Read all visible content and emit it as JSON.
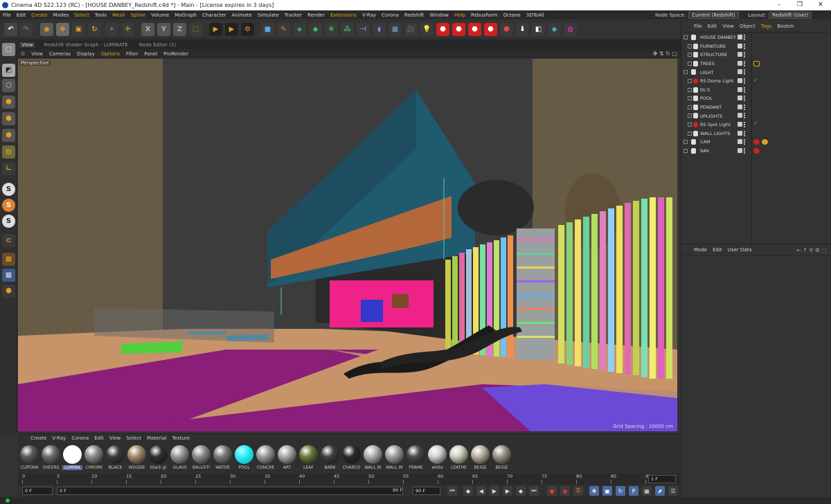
{
  "window": {
    "title": "Cinema 4D S22.123 (RC) - [HOUSE DANBEY_Redshift.c4d *] - Main - [License expires in 3 days]",
    "controls": [
      "–",
      "❐",
      "✕"
    ]
  },
  "menu": [
    "File",
    "Edit",
    "Create",
    "Modes",
    "Select",
    "Tools",
    "Mesh",
    "Spline",
    "Volume",
    "MoGraph",
    "Character",
    "Animate",
    "Simulate",
    "Tracker",
    "Render",
    "Extensions",
    "V-Ray",
    "Corona",
    "Redshift",
    "Window",
    "Help",
    "RebusFarm",
    "Octane",
    "3DToAll"
  ],
  "node_space": {
    "label": "Node Space:",
    "value": "Current (Redshift)"
  },
  "layout": {
    "label": "Layout:",
    "value": "Redshift (User)"
  },
  "viewport_tabs": [
    "View",
    "Redshift Shader Graph - LUMINATE",
    "Node Editor (1)"
  ],
  "viewport_menu": [
    "View",
    "Cameras",
    "Display",
    "Options",
    "Filter",
    "Panel",
    "ProRender"
  ],
  "viewport": {
    "camera_label": "Perspective",
    "grid_spacing": "Grid Spacing : 10000 cm"
  },
  "object_manager": {
    "menu": [
      "File",
      "Edit",
      "View",
      "Object",
      "Tags",
      "Bookm"
    ],
    "objects": [
      {
        "name": "HOUSE DANBEY",
        "type": "layer",
        "tag": ""
      },
      {
        "name": "FURNITURE",
        "type": "layer",
        "tag": ""
      },
      {
        "name": "STRUCTURE",
        "type": "layer",
        "tag": ""
      },
      {
        "name": "TREES",
        "type": "layer",
        "tag": "orange"
      },
      {
        "name": "LIGHT",
        "type": "layer",
        "tag": ""
      },
      {
        "name": "RS Dome Light",
        "type": "rs",
        "tag": "check"
      },
      {
        "name": "DL'S",
        "type": "layer",
        "tag": ""
      },
      {
        "name": "POOL",
        "type": "layer",
        "tag": ""
      },
      {
        "name": "PENDANT",
        "type": "layer",
        "tag": ""
      },
      {
        "name": "UPLIGHTS",
        "type": "layer",
        "tag": ""
      },
      {
        "name": "RS Spot Light",
        "type": "rs",
        "tag": "check"
      },
      {
        "name": "WALL LIGHTS",
        "type": "layer",
        "tag": ""
      },
      {
        "name": "CAM",
        "type": "cam",
        "tag": "red2"
      },
      {
        "name": "NAV",
        "type": "null",
        "tag": "red"
      }
    ]
  },
  "attributes": {
    "menu": [
      "Mode",
      "Edit",
      "User Data"
    ]
  },
  "material_manager": {
    "menu": [
      "Create",
      "V-Ray",
      "Corona",
      "Edit",
      "View",
      "Select",
      "Material",
      "Texture"
    ],
    "materials": [
      {
        "name": "CURTAIN",
        "color": "#5a5a5a"
      },
      {
        "name": "SHEERS",
        "color": "#6a6a6a"
      },
      {
        "name": "LUMINA",
        "color": "#ffffff",
        "selected": true
      },
      {
        "name": "CHROMI",
        "color": "#8a8a8a"
      },
      {
        "name": "BLACK",
        "color": "#3a3a3a"
      },
      {
        "name": "WOODE",
        "color": "#a38a6a"
      },
      {
        "name": "black gl",
        "color": "#2e2e2e"
      },
      {
        "name": "GLASS",
        "color": "#9a9a9a"
      },
      {
        "name": "BALUSTI",
        "color": "#8c8c8c"
      },
      {
        "name": "WATER",
        "color": "#7a7a7a"
      },
      {
        "name": "POOL",
        "color": "#22e6f0"
      },
      {
        "name": "CONCRE",
        "color": "#9c9c9c"
      },
      {
        "name": "ART",
        "color": "#a8a8a8"
      },
      {
        "name": "LEAF",
        "color": "#6a7a3a"
      },
      {
        "name": "BARK",
        "color": "#404040"
      },
      {
        "name": "CHARCO",
        "color": "#2a2a2a"
      },
      {
        "name": "WALL BI",
        "color": "#b0b0b0"
      },
      {
        "name": "WALL W",
        "color": "#a0a0a0"
      },
      {
        "name": "FRAME",
        "color": "#4a4a4a"
      },
      {
        "name": "white",
        "color": "#d0d0d0"
      },
      {
        "name": "LEATHE",
        "color": "#c8d0b8"
      },
      {
        "name": "BEIGE",
        "color": "#b8b0a0"
      },
      {
        "name": "BEIGE",
        "color": "#9c9284"
      }
    ]
  },
  "timeline": {
    "ticks": [
      "0",
      "5",
      "10",
      "15",
      "20",
      "25",
      "30",
      "35",
      "40",
      "45",
      "50",
      "55",
      "60",
      "65",
      "70",
      "75",
      "80",
      "85",
      "90"
    ],
    "current_frame": "1 F"
  },
  "transport": {
    "start": "0 F",
    "current": "0 F",
    "end": "90 F",
    "end2": "90 F"
  },
  "colors": {
    "accent": "#e0a020",
    "selected_material": "#5a6a9a"
  }
}
